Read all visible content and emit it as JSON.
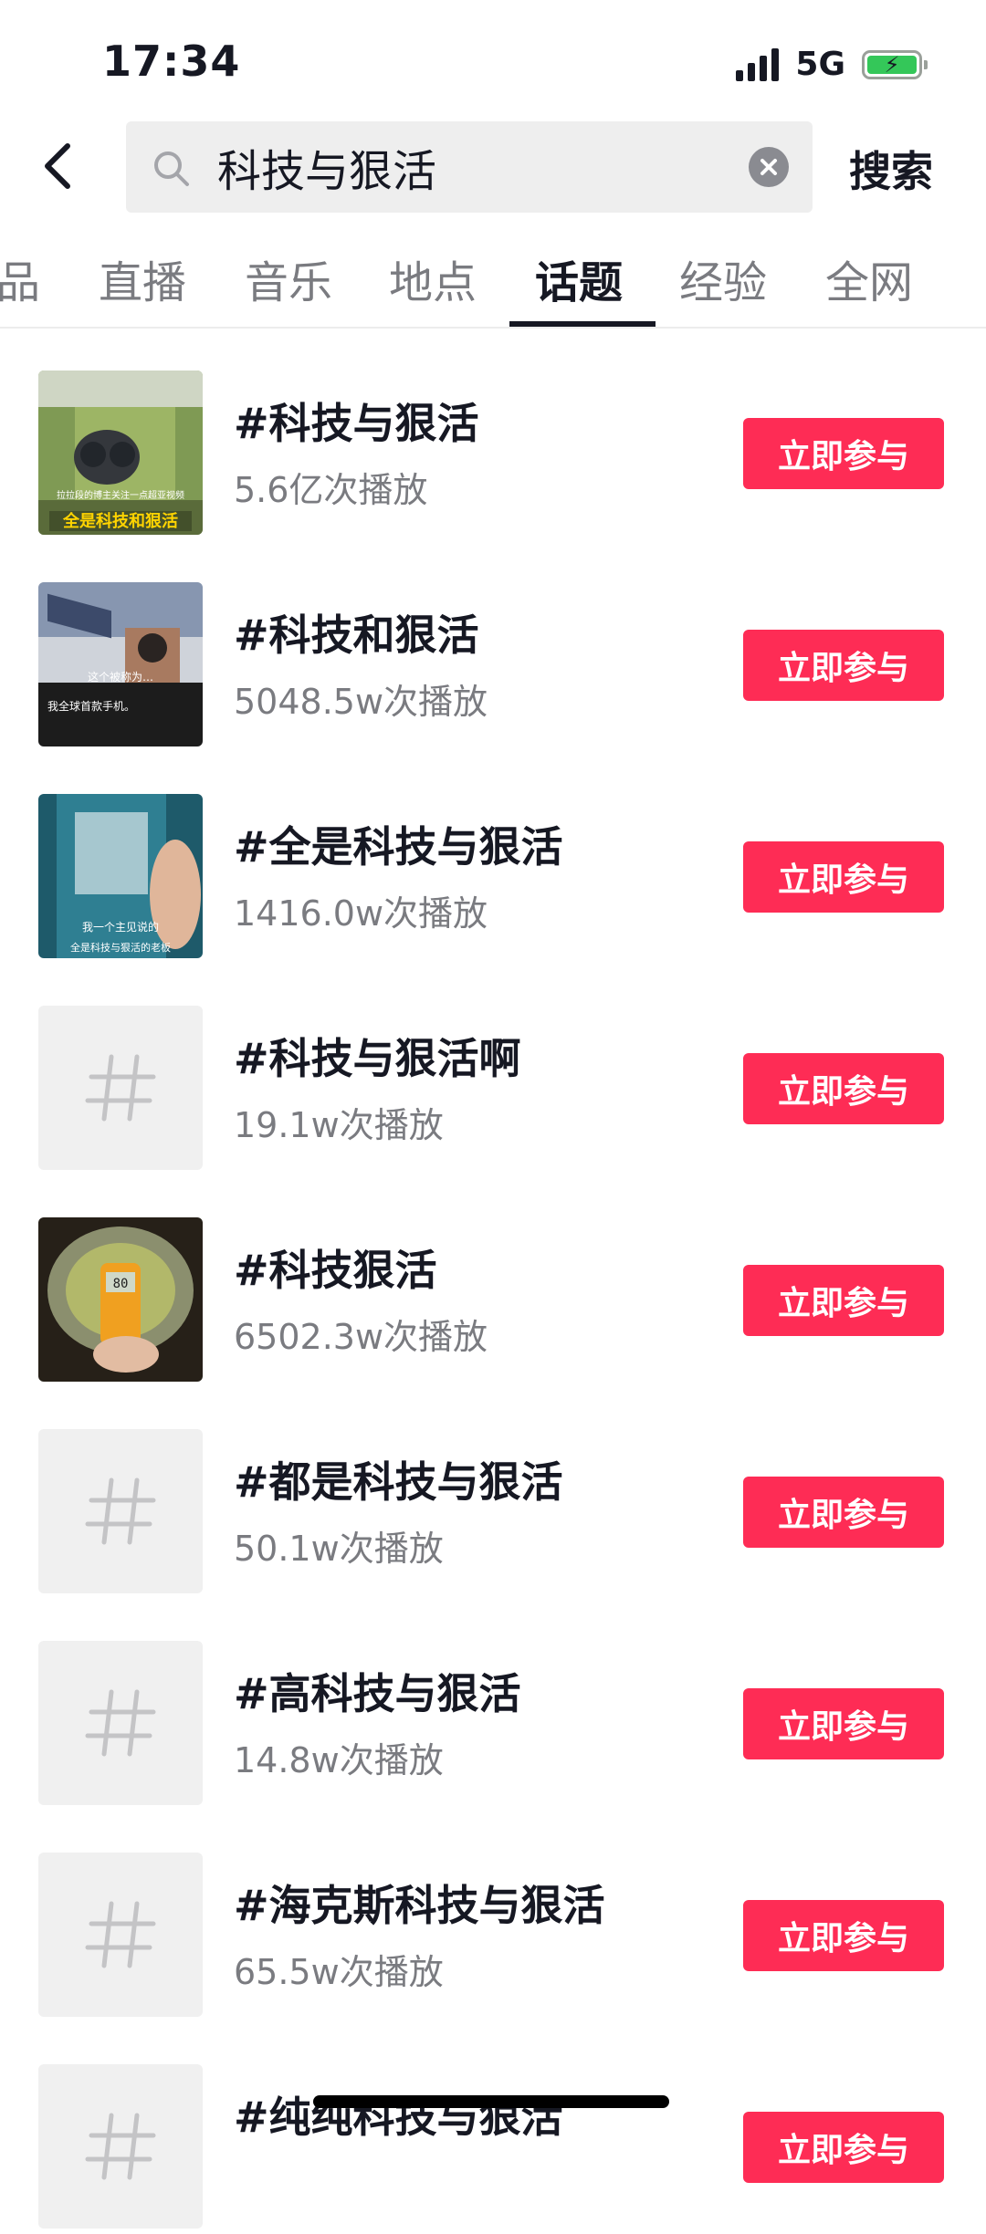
{
  "status_bar": {
    "time": "17:34",
    "network": "5G",
    "battery_color": "#34c759"
  },
  "search": {
    "query": "科技与狠活",
    "placeholder": "",
    "submit_label": "搜索",
    "icons": {
      "back": "chevron-left-icon",
      "search": "search-icon",
      "clear": "clear-icon"
    }
  },
  "tabs": [
    {
      "label": "品",
      "active": false
    },
    {
      "label": "直播",
      "active": false
    },
    {
      "label": "音乐",
      "active": false
    },
    {
      "label": "地点",
      "active": false
    },
    {
      "label": "话题",
      "active": true
    },
    {
      "label": "经验",
      "active": false
    },
    {
      "label": "全网",
      "active": false
    }
  ],
  "topics": [
    {
      "title": "#科技与狠活",
      "views": "5.6亿次播放",
      "button": "立即参与",
      "thumb": {
        "kind": "image",
        "overlay": "全是科技和狠活",
        "caption": "拉拉段的博主关注一点超亚视频"
      }
    },
    {
      "title": "#科技和狠活",
      "views": "5048.5w次播放",
      "button": "立即参与",
      "thumb": {
        "kind": "image",
        "overlay": "这个被称为…",
        "caption": "我全球首款手机。"
      }
    },
    {
      "title": "#全是科技与狠活",
      "views": "1416.0w次播放",
      "button": "立即参与",
      "thumb": {
        "kind": "image",
        "overlay": "我一个主见说的",
        "caption": "全是科技与狠活的老板"
      }
    },
    {
      "title": "#科技与狠活啊",
      "views": "19.1w次播放",
      "button": "立即参与",
      "thumb": {
        "kind": "placeholder"
      }
    },
    {
      "title": "#科技狠活",
      "views": "6502.3w次播放",
      "button": "立即参与",
      "thumb": {
        "kind": "image",
        "overlay": "80",
        "caption": ""
      }
    },
    {
      "title": "#都是科技与狠活",
      "views": "50.1w次播放",
      "button": "立即参与",
      "thumb": {
        "kind": "placeholder"
      }
    },
    {
      "title": "#高科技与狠活",
      "views": "14.8w次播放",
      "button": "立即参与",
      "thumb": {
        "kind": "placeholder"
      }
    },
    {
      "title": "#海克斯科技与狠活",
      "views": "65.5w次播放",
      "button": "立即参与",
      "thumb": {
        "kind": "placeholder"
      }
    },
    {
      "title": "#纯纯科技与狠活",
      "views": "",
      "button": "立即参与",
      "thumb": {
        "kind": "placeholder"
      }
    }
  ],
  "colors": {
    "accent": "#fe2c55",
    "text_primary": "#161823",
    "text_secondary": "#7a7b80",
    "search_bg": "#eeeeee"
  }
}
